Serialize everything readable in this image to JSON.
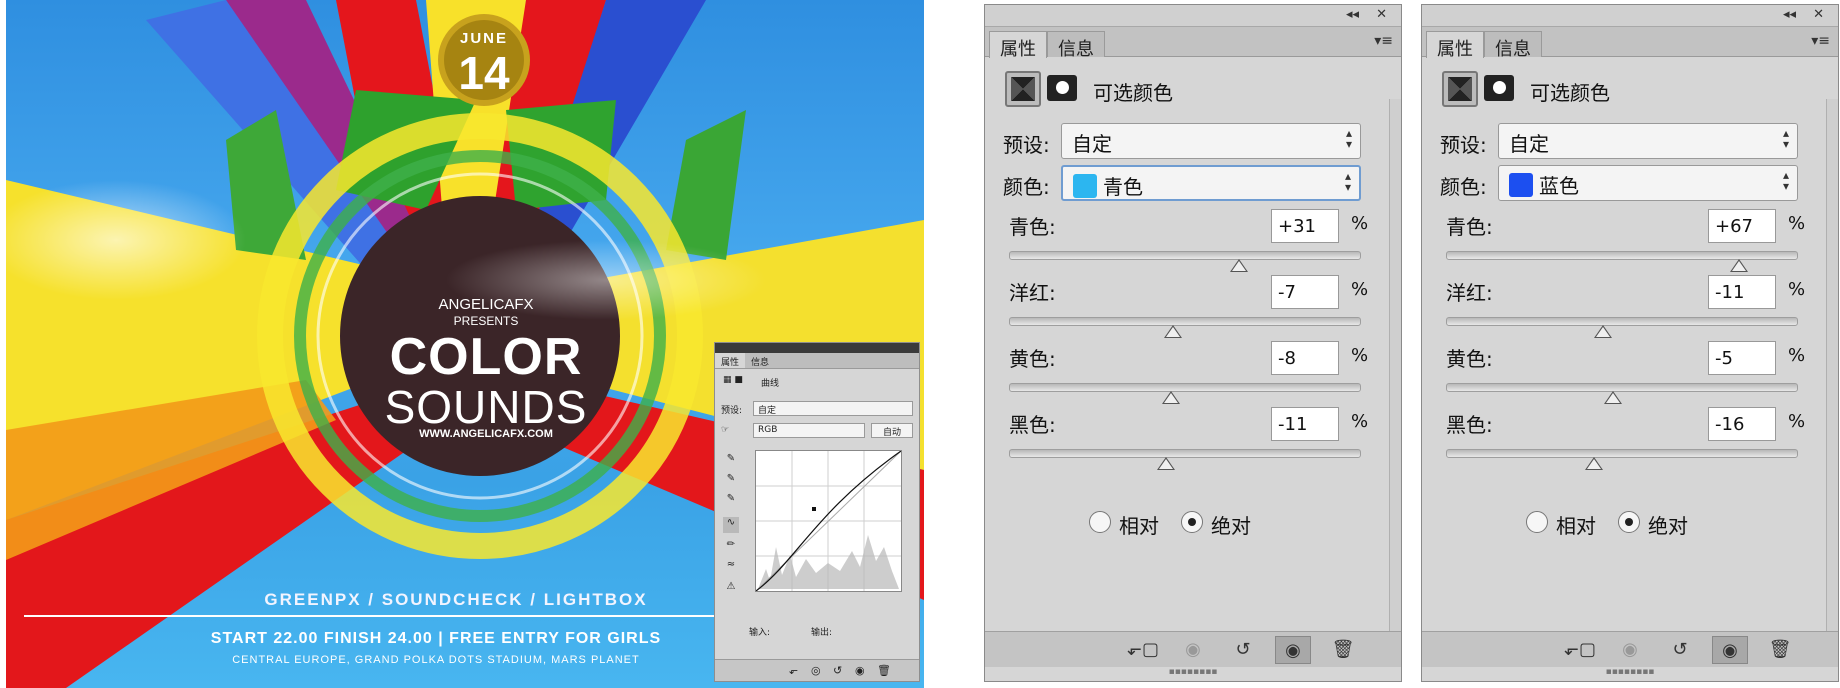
{
  "poster": {
    "month": "JUNE",
    "day": "14",
    "brand": "ANGELICAFX",
    "presents": "PRESENTS",
    "title_line1": "COLOR",
    "title_line2": "SOUNDS",
    "website": "WWW.ANGELICAFX.COM",
    "lineup": "GREENPX / SOUNDCHECK / LIGHTBOX",
    "times": "START 22.00 FINISH 24.00 | FREE ENTRY FOR GIRLS",
    "venue": "CENTRAL EUROPE, GRAND POLKA DOTS STADIUM, MARS PLANET"
  },
  "mini_panel": {
    "tab_properties": "属性",
    "tab_info": "信息",
    "adjustment": "曲线",
    "preset_label": "预设:",
    "preset_value": "自定",
    "channel_value": "RGB",
    "auto_button": "自动",
    "input_label": "输入:",
    "output_label": "输出:"
  },
  "panels": [
    {
      "tab_properties": "属性",
      "tab_info": "信息",
      "adjustment": "可选颜色",
      "preset_label": "预设:",
      "preset_value": "自定",
      "color_label": "颜色:",
      "color_value": "青色",
      "color_swatch": "#2cb6f0",
      "sliders": [
        {
          "label": "青色:",
          "value": "+31",
          "unit": "%",
          "amount": 31
        },
        {
          "label": "洋红:",
          "value": "-7",
          "unit": "%",
          "amount": -7
        },
        {
          "label": "黄色:",
          "value": "-8",
          "unit": "%",
          "amount": -8
        },
        {
          "label": "黑色:",
          "value": "-11",
          "unit": "%",
          "amount": -11
        }
      ],
      "radio_relative": "相对",
      "radio_absolute": "绝对",
      "selected_mode": "absolute"
    },
    {
      "tab_properties": "属性",
      "tab_info": "信息",
      "adjustment": "可选颜色",
      "preset_label": "预设:",
      "preset_value": "自定",
      "color_label": "颜色:",
      "color_value": "蓝色",
      "color_swatch": "#1c4ff0",
      "sliders": [
        {
          "label": "青色:",
          "value": "+67",
          "unit": "%",
          "amount": 67
        },
        {
          "label": "洋红:",
          "value": "-11",
          "unit": "%",
          "amount": -11
        },
        {
          "label": "黄色:",
          "value": "-5",
          "unit": "%",
          "amount": -5
        },
        {
          "label": "黑色:",
          "value": "-16",
          "unit": "%",
          "amount": -16
        }
      ],
      "radio_relative": "相对",
      "radio_absolute": "绝对",
      "selected_mode": "absolute"
    }
  ]
}
